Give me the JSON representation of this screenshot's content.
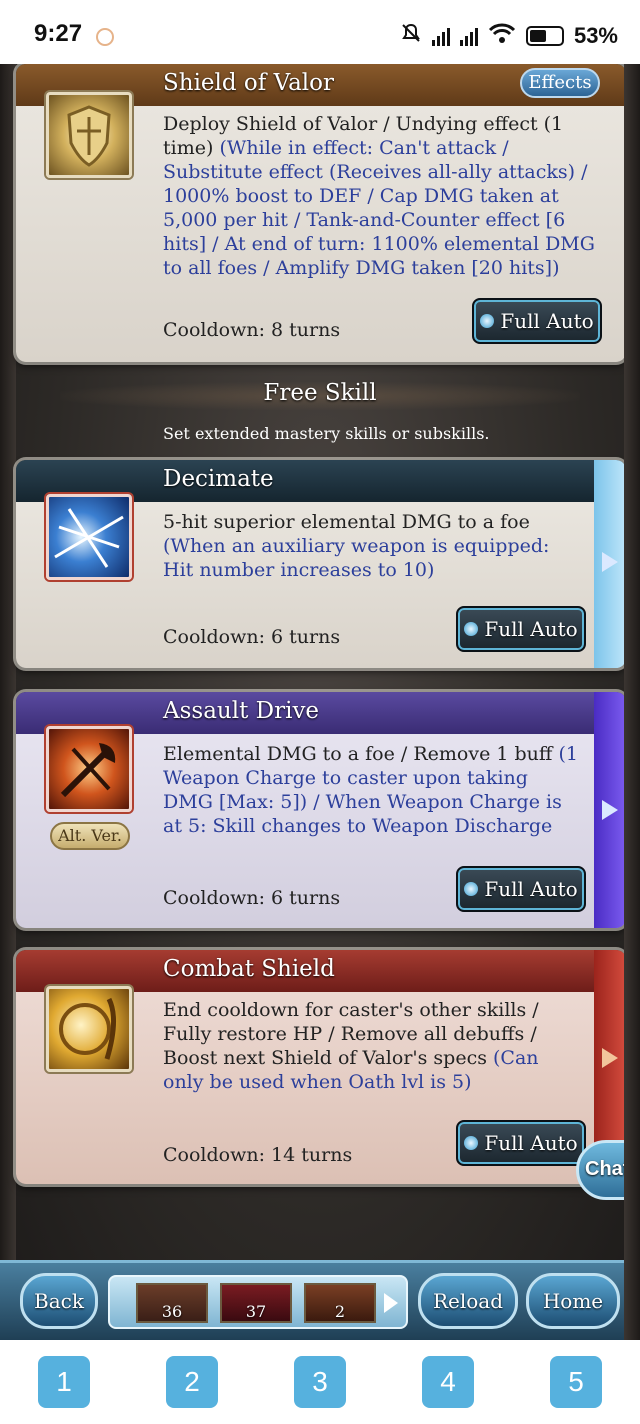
{
  "status_bar": {
    "time": "9:27",
    "battery": "53%"
  },
  "skills_top": {
    "title": "Shield of Valor",
    "effects_label": "Effects",
    "desc_plain": "Deploy Shield of Valor / Undying effect (1 time)",
    "desc_blue": "(While in effect: Can't attack / Substitute effect (Receives all-ally attacks) / 1000% boost to DEF / Cap DMG taken at 5,000 per hit / Tank-and-Counter effect [6 hits] / At end of turn: 1100% elemental DMG to all foes / Amplify DMG taken [20 hits])",
    "cooldown": "Cooldown: 8 turns",
    "button": "Full Auto"
  },
  "free_skill": {
    "title": "Free Skill",
    "subtitle": "Set extended mastery skills or subskills."
  },
  "skills": [
    {
      "title": "Decimate",
      "desc_plain": "5-hit superior elemental DMG to a foe",
      "desc_blue": "(When an auxiliary weapon is equipped: Hit number increases to 10)",
      "cooldown": "Cooldown: 6 turns",
      "button": "Full Auto",
      "header_color": "#1f3340",
      "tab_color": "#9fd3f0"
    },
    {
      "title": "Assault Drive",
      "desc_plain": "Elemental DMG to a foe / Remove 1 buff",
      "desc_blue": "(1 Weapon Charge to caster upon taking DMG [Max: 5]) / When Weapon Charge is at 5: Skill changes to Weapon Discharge",
      "cooldown": "Cooldown: 6 turns",
      "button": "Full Auto",
      "alt_label": "Alt. Ver.",
      "header_color": "#4b3a86",
      "tab_color": "#5b3bd3"
    },
    {
      "title": "Combat Shield",
      "desc_plain": "End cooldown for caster's other skills / Fully restore HP / Remove all debuffs / Boost next Shield of Valor's specs",
      "desc_blue": "(Can only be used when Oath lvl is 5)",
      "cooldown": "Cooldown: 14 turns",
      "button": "Full Auto",
      "header_color": "#8a2a24",
      "tab_color": "#b8342a"
    }
  ],
  "chat_label": "Chat",
  "bottom_bar": {
    "back": "Back",
    "reload": "Reload",
    "home": "Home",
    "items": [
      "36",
      "37",
      "2"
    ]
  },
  "nav_keys": [
    "1",
    "2",
    "3",
    "4",
    "5"
  ]
}
